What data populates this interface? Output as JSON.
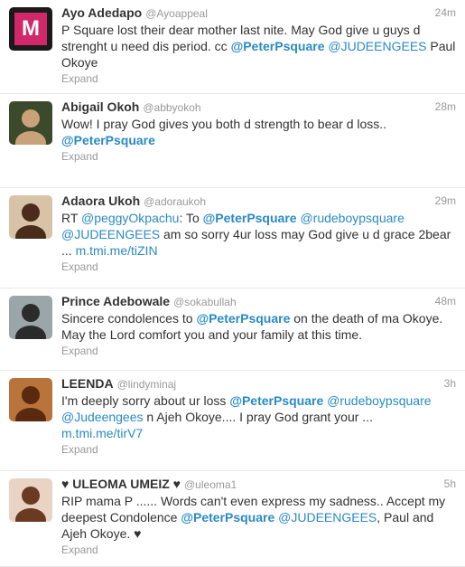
{
  "tweets": [
    {
      "fullname": "Ayo Adedapo",
      "username": "@Ayoappeal",
      "time": "24m",
      "segments": [
        {
          "t": "P Square lost their dear mother last nite. May God give u guys d strenght u need dis period. cc ",
          "k": "text"
        },
        {
          "t": "@PeterPsquare",
          "k": "mention"
        },
        {
          "t": " ",
          "k": "text"
        },
        {
          "t": "@JUDEENGEES",
          "k": "plain-mention"
        },
        {
          "t": " Paul Okoye",
          "k": "text"
        }
      ],
      "expand": "Expand",
      "avatar": {
        "bg": "#1a1a1a",
        "accent": "#d1286a",
        "glyph": "M"
      }
    },
    {
      "fullname": "Abigail Okoh",
      "username": "@abbyokoh",
      "time": "28m",
      "segments": [
        {
          "t": "Wow! I pray God gives you both d strength to bear d loss.. ",
          "k": "text"
        },
        {
          "t": "@PeterPsquare",
          "k": "mention"
        }
      ],
      "expand": "Expand",
      "avatar": {
        "bg": "#3b4a2b",
        "accent": "#c9a27a",
        "glyph": ""
      }
    },
    {
      "fullname": "Adaora Ukoh",
      "username": "@adoraukoh",
      "time": "29m",
      "segments": [
        {
          "t": "RT ",
          "k": "text"
        },
        {
          "t": "@peggyOkpachu",
          "k": "plain-mention"
        },
        {
          "t": ": To ",
          "k": "text"
        },
        {
          "t": "@PeterPsquare",
          "k": "mention"
        },
        {
          "t": " ",
          "k": "text"
        },
        {
          "t": "@rudeboypsquare",
          "k": "plain-mention"
        },
        {
          "t": " ",
          "k": "text"
        },
        {
          "t": "@JUDEENGEES",
          "k": "plain-mention"
        },
        {
          "t": " am so sorry 4ur loss may God give u d grace 2bear ... ",
          "k": "text"
        },
        {
          "t": "m.tmi.me/tiZIN",
          "k": "link"
        }
      ],
      "expand": "Expand",
      "avatar": {
        "bg": "#d8c2a8",
        "accent": "#4a2c1a",
        "glyph": ""
      }
    },
    {
      "fullname": "Prince Adebowale",
      "username": "@sokabullah",
      "time": "48m",
      "segments": [
        {
          "t": "Sincere condolences to ",
          "k": "text"
        },
        {
          "t": "@PeterPsquare",
          "k": "mention"
        },
        {
          "t": " on the death of ma Okoye. May the Lord comfort you and your family at this time.",
          "k": "text"
        }
      ],
      "expand": "Expand",
      "avatar": {
        "bg": "#9aa6a8",
        "accent": "#2b2b2b",
        "glyph": ""
      }
    },
    {
      "fullname": "LEENDA",
      "username": "@lindyminaj",
      "time": "3h",
      "segments": [
        {
          "t": "I'm deeply sorry about ur loss ",
          "k": "text"
        },
        {
          "t": "@PeterPsquare",
          "k": "mention"
        },
        {
          "t": " ",
          "k": "text"
        },
        {
          "t": "@rudeboypsquare",
          "k": "plain-mention"
        },
        {
          "t": " ",
          "k": "text"
        },
        {
          "t": "@Judeengees",
          "k": "plain-mention"
        },
        {
          "t": " n Ajeh Okoye.... I pray God grant your ... ",
          "k": "text"
        },
        {
          "t": "m.tmi.me/tirV7",
          "k": "link"
        }
      ],
      "expand": "Expand",
      "avatar": {
        "bg": "#b8743a",
        "accent": "#5a2a10",
        "glyph": ""
      }
    },
    {
      "fullname": "♥ ULEOMA UMEIZ ♥",
      "username": "@uleoma1",
      "time": "5h",
      "segments": [
        {
          "t": "RIP mama P ...... Words can't even express my sadness.. Accept my deepest Condolence ",
          "k": "text"
        },
        {
          "t": "@PeterPsquare",
          "k": "mention"
        },
        {
          "t": " ",
          "k": "text"
        },
        {
          "t": "@JUDEENGEES",
          "k": "plain-mention"
        },
        {
          "t": ", Paul and Ajeh Okoye. ♥",
          "k": "text"
        }
      ],
      "expand": "Expand",
      "avatar": {
        "bg": "#e9d3c3",
        "accent": "#6b3a22",
        "glyph": ""
      }
    }
  ]
}
